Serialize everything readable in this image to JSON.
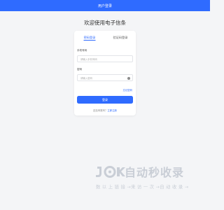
{
  "header": {
    "title": "用户登录"
  },
  "welcome": "欢迎使用电子信条",
  "tabs": [
    {
      "label": "密码登录",
      "active": true
    },
    {
      "label": "验证码登录",
      "active": false
    }
  ],
  "form": {
    "account_label": "手机号码",
    "account_placeholder": "请输入手机号码",
    "password_label": "密码",
    "password_placeholder": "请输入密码",
    "forgot_label": "忘记密码",
    "submit_label": "登录",
    "register_prompt": "还没有账号？",
    "register_link": "立即注册"
  },
  "watermark": {
    "title": "自动秒收录",
    "subtitle": "数 以 上 链 接 →来 访 一 次 →自 动 收 录 →"
  },
  "colors": {
    "brand": "#2f6bff",
    "background": "#f4f5f7",
    "watermark": "#c9ced6"
  }
}
